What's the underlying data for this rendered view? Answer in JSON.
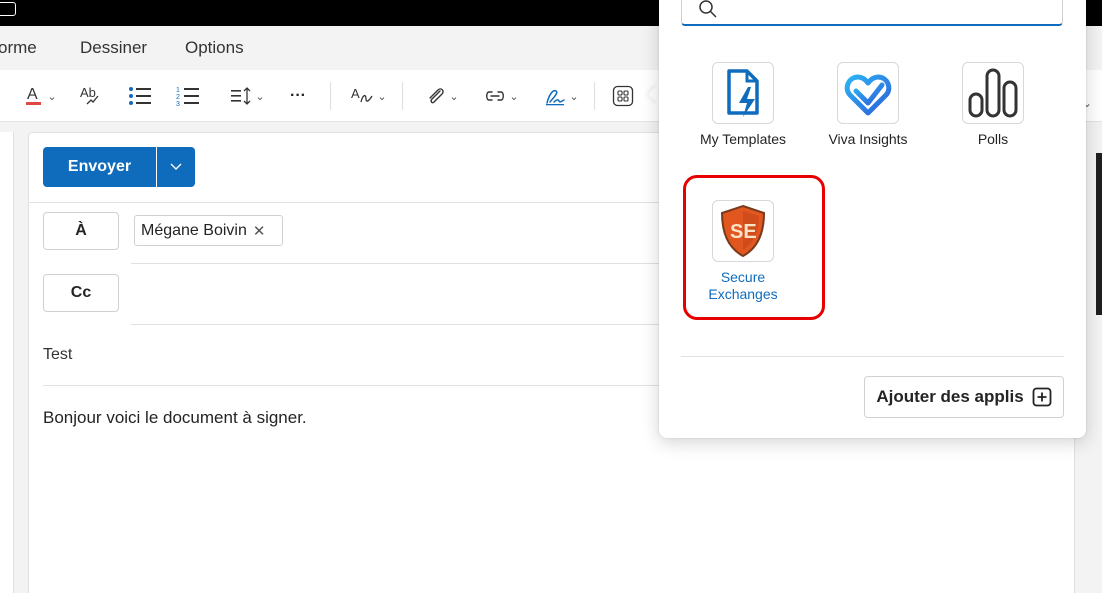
{
  "menu": {
    "items": [
      "orme",
      "Dessiner",
      "Options"
    ]
  },
  "toolbar": {
    "more_label": "···"
  },
  "compose": {
    "send_label": "Envoyer",
    "to_label": "À",
    "cc_label": "Cc",
    "recipient_name": "Mégane Boivin",
    "subject": "Test",
    "body": "Bonjour voici le document à signer."
  },
  "apps_popup": {
    "apps": [
      {
        "label": "My Templates",
        "icon": "document-lightning-icon"
      },
      {
        "label": "Viva Insights",
        "icon": "viva-insights-icon"
      },
      {
        "label": "Polls",
        "icon": "polls-icon"
      },
      {
        "label": "Secure\nExchanges",
        "icon": "secure-exchanges-shield-icon"
      }
    ],
    "add_apps_label": "Ajouter des applis"
  },
  "colors": {
    "accent": "#0f6cbd",
    "highlight": "#e60000",
    "secure_exchanges": "#e2571f"
  }
}
